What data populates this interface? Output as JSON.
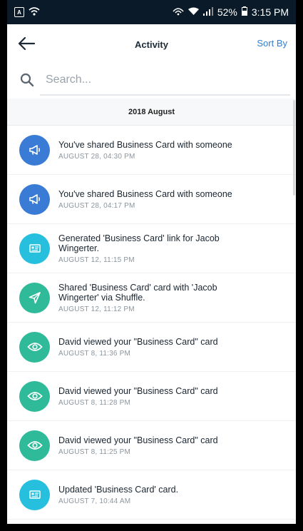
{
  "status_bar": {
    "battery": "52%",
    "time": "3:15 PM"
  },
  "header": {
    "title": "Activity",
    "sort_label": "Sort By"
  },
  "search": {
    "placeholder": "Search..."
  },
  "section": {
    "label": "2018 August"
  },
  "colors": {
    "blue": "#3a7bd5",
    "cyan": "#26c0de",
    "green": "#2fbb9a",
    "accent": "#2f7fd6"
  },
  "activities": [
    {
      "icon": "megaphone-icon",
      "color": "blue",
      "title": "You've shared Business Card with someone",
      "date": "AUGUST 28, 04:30 PM"
    },
    {
      "icon": "megaphone-icon",
      "color": "blue",
      "title": "You've shared Business Card with someone",
      "date": "AUGUST 28, 04:17 PM"
    },
    {
      "icon": "card-icon",
      "color": "cyan",
      "title": "Generated 'Business Card' link for Jacob Wingerter.",
      "date": "AUGUST 12, 11:15 PM"
    },
    {
      "icon": "send-icon",
      "color": "green",
      "title": "Shared 'Business Card' card with 'Jacob Wingerter' via Shuffle.",
      "date": "AUGUST 12, 11:12 PM"
    },
    {
      "icon": "eye-icon",
      "color": "green",
      "title": "David viewed your \"Business Card\" card",
      "date": "AUGUST 8, 11:36 PM"
    },
    {
      "icon": "eye-icon",
      "color": "green",
      "title": "David viewed your \"Business Card\" card",
      "date": "AUGUST 8, 11:28 PM"
    },
    {
      "icon": "eye-icon",
      "color": "green",
      "title": "David viewed your \"Business Card\" card",
      "date": "AUGUST 8, 11:25 PM"
    },
    {
      "icon": "card-icon",
      "color": "cyan",
      "title": "Updated 'Business Card' card.",
      "date": "AUGUST 7, 10:44 AM"
    }
  ]
}
